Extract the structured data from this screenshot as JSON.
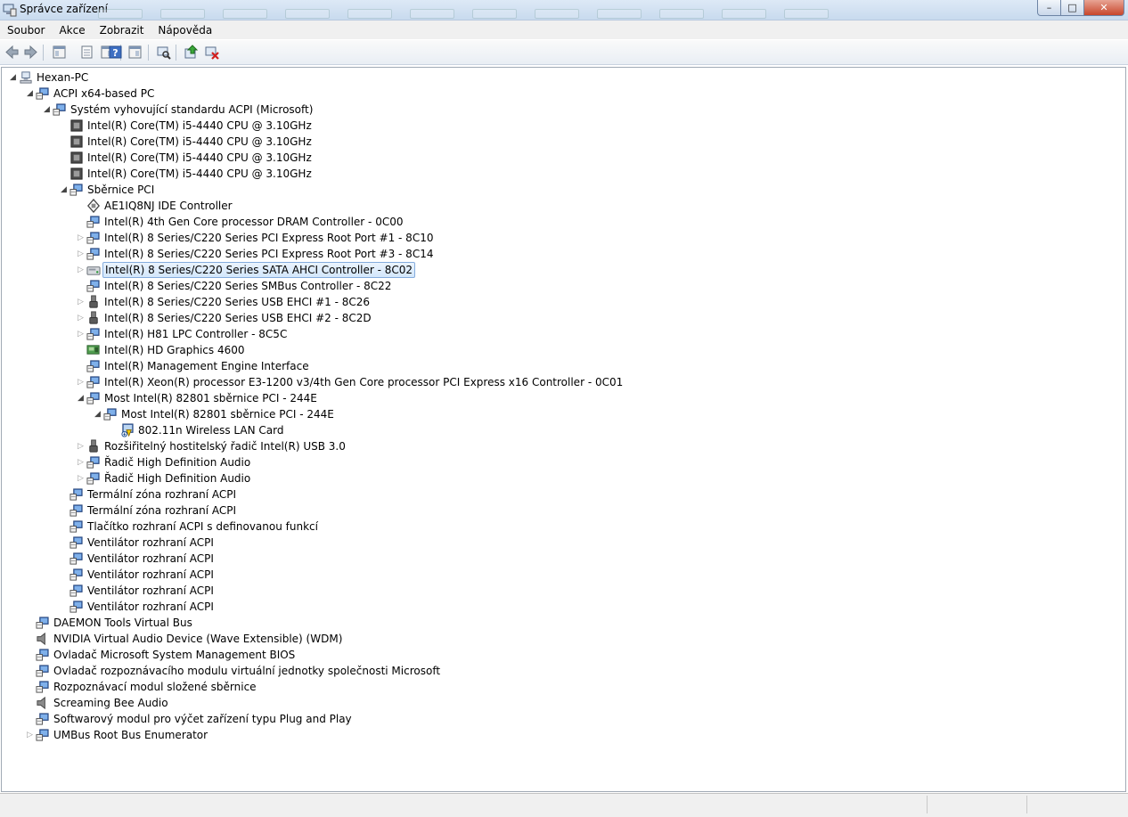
{
  "window": {
    "title": "Správce zařízení"
  },
  "menu": [
    "Soubor",
    "Akce",
    "Zobrazit",
    "Nápověda"
  ],
  "toolbar": [
    {
      "name": "back-icon"
    },
    {
      "name": "forward-icon"
    },
    {
      "name": "properties-pane-icon"
    },
    {
      "name": "device-properties-icon"
    },
    {
      "name": "list-view-icon"
    },
    {
      "name": "help-icon"
    },
    {
      "name": "action-pane-icon"
    },
    {
      "name": "scan-hardware-icon"
    },
    {
      "name": "update-driver-icon"
    },
    {
      "name": "uninstall-icon"
    }
  ],
  "tree": [
    {
      "level": 0,
      "arrow": "expanded",
      "icon": "computer-icon",
      "label": "Hexan-PC"
    },
    {
      "level": 1,
      "arrow": "expanded",
      "icon": "system-device-icon",
      "label": "ACPI x64-based PC"
    },
    {
      "level": 2,
      "arrow": "expanded",
      "icon": "system-device-icon",
      "label": "Systém vyhovující standardu ACPI (Microsoft)"
    },
    {
      "level": 3,
      "arrow": "none",
      "icon": "processor-icon",
      "label": "Intel(R) Core(TM) i5-4440 CPU @ 3.10GHz"
    },
    {
      "level": 3,
      "arrow": "none",
      "icon": "processor-icon",
      "label": "Intel(R) Core(TM) i5-4440 CPU @ 3.10GHz"
    },
    {
      "level": 3,
      "arrow": "none",
      "icon": "processor-icon",
      "label": "Intel(R) Core(TM) i5-4440 CPU @ 3.10GHz"
    },
    {
      "level": 3,
      "arrow": "none",
      "icon": "processor-icon",
      "label": "Intel(R) Core(TM) i5-4440 CPU @ 3.10GHz"
    },
    {
      "level": 3,
      "arrow": "expanded",
      "icon": "system-device-icon",
      "label": "Sběrnice PCI"
    },
    {
      "level": 4,
      "arrow": "none",
      "icon": "ide-controller-icon",
      "label": "AE1IQ8NJ IDE Controller"
    },
    {
      "level": 4,
      "arrow": "none",
      "icon": "system-device-icon",
      "label": "Intel(R) 4th Gen Core processor DRAM Controller - 0C00"
    },
    {
      "level": 4,
      "arrow": "collapsed",
      "icon": "system-device-icon",
      "label": "Intel(R) 8 Series/C220 Series PCI Express Root Port #1 - 8C10"
    },
    {
      "level": 4,
      "arrow": "collapsed",
      "icon": "system-device-icon",
      "label": "Intel(R) 8 Series/C220 Series PCI Express Root Port #3 - 8C14"
    },
    {
      "level": 4,
      "arrow": "collapsed",
      "icon": "storage-controller-icon",
      "label": "Intel(R) 8 Series/C220 Series SATA AHCI Controller - 8C02",
      "selected": true
    },
    {
      "level": 4,
      "arrow": "none",
      "icon": "system-device-icon",
      "label": "Intel(R) 8 Series/C220 Series SMBus Controller - 8C22"
    },
    {
      "level": 4,
      "arrow": "collapsed",
      "icon": "usb-icon",
      "label": "Intel(R) 8 Series/C220 Series USB EHCI #1 - 8C26"
    },
    {
      "level": 4,
      "arrow": "collapsed",
      "icon": "usb-icon",
      "label": "Intel(R) 8 Series/C220 Series USB EHCI #2 - 8C2D"
    },
    {
      "level": 4,
      "arrow": "collapsed",
      "icon": "system-device-icon",
      "label": "Intel(R) H81 LPC Controller - 8C5C"
    },
    {
      "level": 4,
      "arrow": "none",
      "icon": "display-adapter-icon",
      "label": "Intel(R) HD Graphics 4600"
    },
    {
      "level": 4,
      "arrow": "none",
      "icon": "system-device-icon",
      "label": "Intel(R) Management Engine Interface"
    },
    {
      "level": 4,
      "arrow": "collapsed",
      "icon": "system-device-icon",
      "label": "Intel(R) Xeon(R) processor E3-1200 v3/4th Gen Core processor PCI Express x16 Controller - 0C01"
    },
    {
      "level": 4,
      "arrow": "expanded",
      "icon": "system-device-icon",
      "label": "Most Intel(R) 82801 sběrnice PCI - 244E"
    },
    {
      "level": 5,
      "arrow": "expanded",
      "icon": "system-device-icon",
      "label": "Most Intel(R) 82801 sběrnice PCI - 244E"
    },
    {
      "level": 6,
      "arrow": "none",
      "icon": "network-adapter-warning-icon",
      "label": "802.11n Wireless LAN Card"
    },
    {
      "level": 4,
      "arrow": "collapsed",
      "icon": "usb-icon",
      "label": "Rozšiřitelný hostitelský řadič Intel(R) USB 3.0"
    },
    {
      "level": 4,
      "arrow": "collapsed",
      "icon": "system-device-icon",
      "label": "Řadič High Definition Audio"
    },
    {
      "level": 4,
      "arrow": "collapsed",
      "icon": "system-device-icon",
      "label": "Řadič High Definition Audio"
    },
    {
      "level": 3,
      "arrow": "none",
      "icon": "system-device-icon",
      "label": "Termální zóna rozhraní ACPI"
    },
    {
      "level": 3,
      "arrow": "none",
      "icon": "system-device-icon",
      "label": "Termální zóna rozhraní ACPI"
    },
    {
      "level": 3,
      "arrow": "none",
      "icon": "system-device-icon",
      "label": "Tlačítko rozhraní ACPI s definovanou funkcí"
    },
    {
      "level": 3,
      "arrow": "none",
      "icon": "system-device-icon",
      "label": "Ventilátor rozhraní ACPI"
    },
    {
      "level": 3,
      "arrow": "none",
      "icon": "system-device-icon",
      "label": "Ventilátor rozhraní ACPI"
    },
    {
      "level": 3,
      "arrow": "none",
      "icon": "system-device-icon",
      "label": "Ventilátor rozhraní ACPI"
    },
    {
      "level": 3,
      "arrow": "none",
      "icon": "system-device-icon",
      "label": "Ventilátor rozhraní ACPI"
    },
    {
      "level": 3,
      "arrow": "none",
      "icon": "system-device-icon",
      "label": "Ventilátor rozhraní ACPI"
    },
    {
      "level": 1,
      "arrow": "none",
      "icon": "system-device-icon",
      "label": "DAEMON Tools Virtual Bus"
    },
    {
      "level": 1,
      "arrow": "none",
      "icon": "speaker-icon",
      "label": "NVIDIA Virtual Audio Device (Wave Extensible) (WDM)"
    },
    {
      "level": 1,
      "arrow": "none",
      "icon": "system-device-icon",
      "label": "Ovladač Microsoft System Management BIOS"
    },
    {
      "level": 1,
      "arrow": "none",
      "icon": "system-device-icon",
      "label": "Ovladač rozpoznávacího modulu virtuální jednotky společnosti Microsoft"
    },
    {
      "level": 1,
      "arrow": "none",
      "icon": "system-device-icon",
      "label": "Rozpoznávací modul složené sběrnice"
    },
    {
      "level": 1,
      "arrow": "none",
      "icon": "speaker-icon",
      "label": "Screaming Bee Audio"
    },
    {
      "level": 1,
      "arrow": "none",
      "icon": "system-device-icon",
      "label": "Softwarový modul pro výčet zařízení typu Plug and Play"
    },
    {
      "level": 1,
      "arrow": "collapsed",
      "icon": "system-device-icon",
      "label": "UMBus Root Bus Enumerator"
    }
  ]
}
